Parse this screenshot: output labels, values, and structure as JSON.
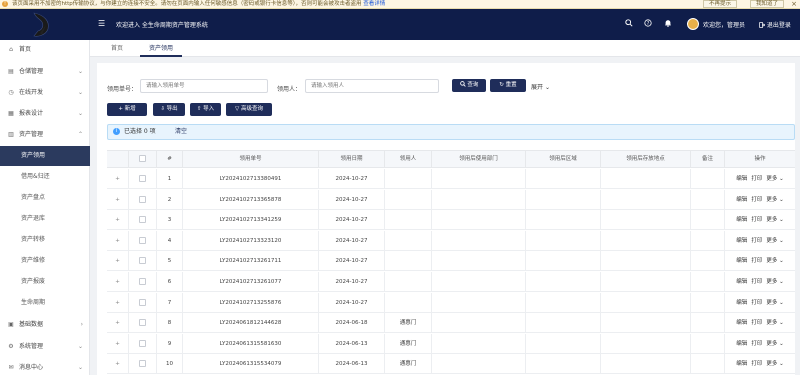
{
  "warning": {
    "text": "该页面采用不加密的http传输协议，与你建立的连接不安全。请勿在页面内输入任何敏感信息（密码或银行卡信息等），否则可能会被攻击者盗用",
    "link": "查看详情",
    "dont_remind": "不再提示",
    "got_it": "我知道了",
    "close": "×"
  },
  "header": {
    "menu_icon": "☰",
    "title": "欢迎进入 全生命周期资产管理系统",
    "welcome": "欢迎您，管理员",
    "logout": "退出登录"
  },
  "sidebar": {
    "items": [
      {
        "label": "首页",
        "icon": "⌂",
        "arrow": ""
      },
      {
        "label": "仓储管理",
        "icon": "▤",
        "arrow": "⌄"
      },
      {
        "label": "在线开发",
        "icon": "◷",
        "arrow": "⌄"
      },
      {
        "label": "报表设计",
        "icon": "▦",
        "arrow": "⌄"
      },
      {
        "label": "资产管理",
        "icon": "▥",
        "arrow": "⌃"
      }
    ],
    "sub_items": [
      "资产领用",
      "借用&归还",
      "资产盘点",
      "资产退库",
      "资产转移",
      "资产维修",
      "资产报废",
      "生命周期"
    ],
    "bottom_items": [
      {
        "label": "基础数据",
        "icon": "▣",
        "arrow": "›"
      },
      {
        "label": "系统管理",
        "icon": "⚙",
        "arrow": "⌄"
      },
      {
        "label": "消息中心",
        "icon": "✉",
        "arrow": "⌄"
      }
    ]
  },
  "tabs": [
    "首页",
    "资产领用"
  ],
  "filters": {
    "order_label": "领用单号：",
    "order_placeholder": "请输入领用单号",
    "person_label": "领用人：",
    "person_placeholder": "请输入领用人",
    "search": "查询",
    "reset": "重置",
    "expand": "展开"
  },
  "toolbar": {
    "add": "新增",
    "export": "导出",
    "import": "导入",
    "advanced": "高级查询"
  },
  "selection": {
    "text": "已选择 0 项",
    "clear": "清空"
  },
  "table": {
    "headers": [
      "#",
      "领用单号",
      "领用日期",
      "领用人",
      "领用后使用部门",
      "领用后区域",
      "领用后存放地点",
      "备注",
      "操作"
    ],
    "rows": [
      {
        "n": "1",
        "no": "LY20241027133804​91",
        "date": "2024-10-27",
        "person": ""
      },
      {
        "n": "2",
        "no": "LY2024102713365878",
        "date": "2024-10-27",
        "person": ""
      },
      {
        "n": "3",
        "no": "LY2024102713341259",
        "date": "2024-10-27",
        "person": ""
      },
      {
        "n": "4",
        "no": "LY2024102713323120",
        "date": "2024-10-27",
        "person": ""
      },
      {
        "n": "5",
        "no": "LY2024102713261711",
        "date": "2024-10-27",
        "person": ""
      },
      {
        "n": "6",
        "no": "LY2024102713261077",
        "date": "2024-10-27",
        "person": ""
      },
      {
        "n": "7",
        "no": "LY2024102713255876",
        "date": "2024-10-27",
        "person": ""
      },
      {
        "n": "8",
        "no": "LY2024061812144628",
        "date": "2024-06-18",
        "person": "通惠门"
      },
      {
        "n": "9",
        "no": "LY2024061315581630",
        "date": "2024-06-13",
        "person": "通惠门"
      },
      {
        "n": "10",
        "no": "LY2024061315534079",
        "date": "2024-06-13",
        "person": "通惠门"
      }
    ],
    "ops": {
      "edit": "编辑",
      "print": "打印",
      "more": "更多"
    }
  },
  "colors": {
    "primary": "#1f2d5a",
    "header_bg": "#0f1d4a",
    "active_menu": "#2b3a5e"
  }
}
